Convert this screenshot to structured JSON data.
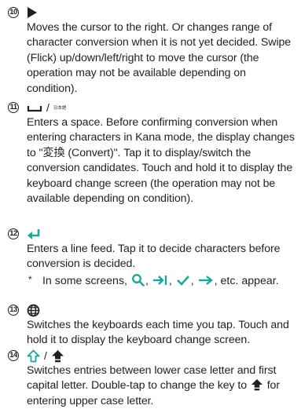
{
  "colors": {
    "accent": "#1aa79a",
    "text": "#231f20"
  },
  "items": [
    {
      "number": "10",
      "icon": "play-right-icon",
      "description": "Moves the cursor to the right. Or changes range of character conversion when it is not yet decided. Swipe (Flick) up/down/left/right to move the cursor (the operation may not be available depending on condition)."
    },
    {
      "number": "11",
      "icon": "space-key-icon",
      "separator": "/",
      "alt_key_label": "日本語",
      "description": "Enters a space. Before confirming conversion when entering characters in Kana mode, the display changes to \"変換 (Convert)\". Tap it to display/switch the conversion candidates. Touch and hold it to display the keyboard change screen (the operation may not be available depending on condition)."
    },
    {
      "number": "12",
      "icon": "enter-key-icon",
      "description": "Enters a line feed. Tap it to decide characters before conversion is decided.",
      "note": {
        "marker": "*",
        "prefix": "In some screens,",
        "suffix": ", etc. appear.",
        "icons": [
          "search-icon",
          "next-field-icon",
          "done-check-icon",
          "go-arrow-icon"
        ]
      }
    },
    {
      "number": "13",
      "icon": "globe-icon",
      "description": "Switches the keyboards each time you tap. Touch and hold it to display the keyboard change screen."
    },
    {
      "number": "14",
      "icon": "shift-outline-icon",
      "separator": "/",
      "alt_icon": "shift-filled-icon",
      "description_before": "Switches entries between lower case letter and first capital letter. Double-tap to change the key to",
      "description_after": "for entering upper case letter."
    }
  ]
}
